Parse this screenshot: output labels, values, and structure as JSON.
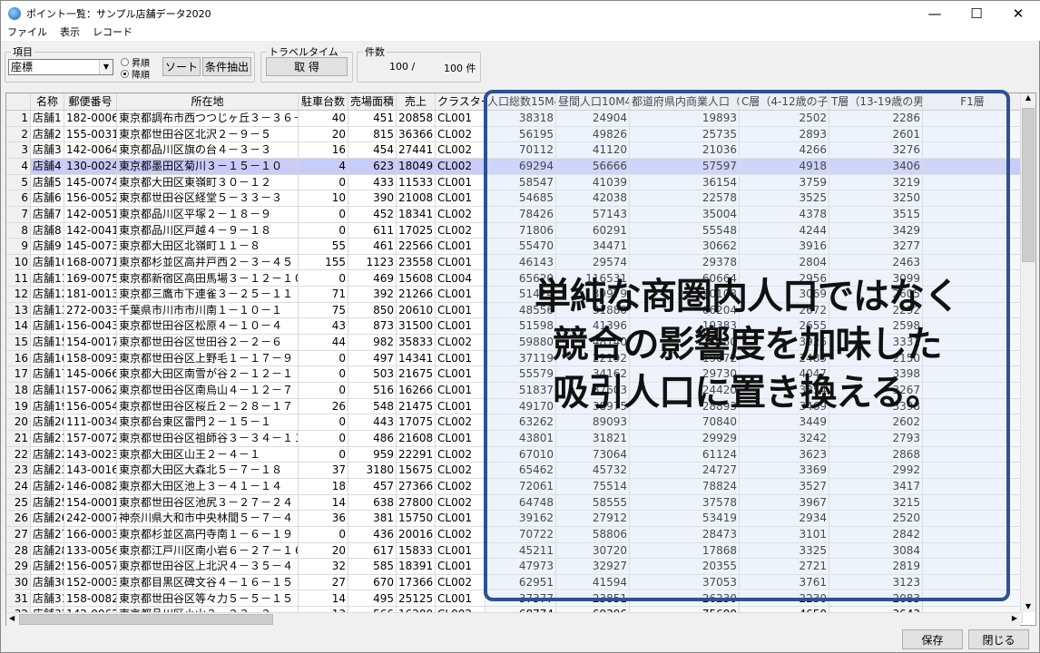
{
  "window": {
    "title": "ポイント一覧：サンプル店舗データ2020",
    "minimize": "—",
    "maximize": "☐",
    "close": "✕"
  },
  "menu": [
    "ファイル",
    "表示",
    "レコード"
  ],
  "toolbar": {
    "item_group": "項目",
    "item_value": "座標",
    "asc": "昇順",
    "desc": "降順",
    "sort_order": "desc",
    "sort_button": "ソート",
    "filter_button": "条件抽出",
    "travel_group": "トラベルタイム",
    "get_button": "取 得",
    "count_group": "件数",
    "count_shown": "100 /",
    "count_total": "100 件"
  },
  "columns": [
    "",
    "名称",
    "郵便番号",
    "所在地",
    "駐車台数",
    "売場面積",
    "売上",
    "クラスター",
    "人口総数15M4W",
    "昼間人口10M4W",
    "都道府県内商業人口（人）",
    "C層（4-12歳の子供）",
    "T層（13-19歳の男女",
    "F1層"
  ],
  "selected_row": 4,
  "rows": [
    [
      "1",
      "店舗1",
      "182-0006",
      "東京都調布市西つつじヶ丘３－３６－１",
      "40",
      "451",
      "20858",
      "CL001",
      "38318",
      "24904",
      "19893",
      "2502",
      "2286",
      ""
    ],
    [
      "2",
      "店舗2",
      "155-0031",
      "東京都世田谷区北沢２－９－５",
      "20",
      "815",
      "36366",
      "CL002",
      "56195",
      "49826",
      "25735",
      "2893",
      "2601",
      ""
    ],
    [
      "3",
      "店舗3",
      "142-0064",
      "東京都品川区旗の台４－３－３",
      "16",
      "454",
      "27441",
      "CL002",
      "70112",
      "41120",
      "21036",
      "4266",
      "3276",
      ""
    ],
    [
      "4",
      "店舗4",
      "130-0024",
      "東京都墨田区菊川３－１５－１０",
      "4",
      "623",
      "18049",
      "CL002",
      "69294",
      "56666",
      "57597",
      "4918",
      "3406",
      ""
    ],
    [
      "5",
      "店舗5",
      "145-0074",
      "東京都大田区東嶺町３０－１２",
      "0",
      "433",
      "11533",
      "CL001",
      "58547",
      "41039",
      "36154",
      "3759",
      "3219",
      ""
    ],
    [
      "6",
      "店舗6",
      "156-0052",
      "東京都世田谷区経堂５－３３－３",
      "10",
      "390",
      "21008",
      "CL001",
      "54685",
      "42038",
      "22578",
      "3525",
      "3250",
      ""
    ],
    [
      "7",
      "店舗7",
      "142-0051",
      "東京都品川区平塚２－１８－９",
      "0",
      "452",
      "18341",
      "CL002",
      "78426",
      "57143",
      "35004",
      "4378",
      "3515",
      ""
    ],
    [
      "8",
      "店舗8",
      "142-0041",
      "東京都品川区戸越４－９－１８",
      "0",
      "611",
      "17025",
      "CL002",
      "71806",
      "60291",
      "55548",
      "4244",
      "3429",
      ""
    ],
    [
      "9",
      "店舗9",
      "145-0073",
      "東京都大田区北嶺町１１－８",
      "55",
      "461",
      "22566",
      "CL001",
      "55470",
      "34471",
      "30662",
      "3916",
      "3277",
      ""
    ],
    [
      "10",
      "店舗10",
      "168-0071",
      "東京都杉並区高井戸西２－３－４５",
      "155",
      "1123",
      "23558",
      "CL001",
      "46143",
      "29574",
      "29378",
      "2804",
      "2463",
      ""
    ],
    [
      "11",
      "店舗11",
      "169-0075",
      "東京都新宿区高田馬場３－１２－１０",
      "0",
      "469",
      "15608",
      "CL004",
      "65620",
      "116531",
      "60664",
      "2956",
      "3099",
      ""
    ],
    [
      "12",
      "店舗12",
      "181-0013",
      "東京都三鷹市下連雀３－２５－１１",
      "71",
      "392",
      "21266",
      "CL001",
      "51424",
      "39979",
      "20108",
      "3069",
      "2605",
      ""
    ],
    [
      "13",
      "店舗13",
      "272-0033",
      "千葉県市川市市川南１－１０－１",
      "75",
      "850",
      "20610",
      "CL001",
      "48556",
      "31880",
      "66204",
      "2672",
      "2292",
      ""
    ],
    [
      "14",
      "店舗14",
      "156-0043",
      "東京都世田谷区松原４－１０－４",
      "43",
      "873",
      "31500",
      "CL001",
      "51598",
      "41396",
      "19383",
      "2655",
      "2598",
      ""
    ],
    [
      "15",
      "店舗15",
      "154-0017",
      "東京都世田谷区世田谷２－２－６",
      "44",
      "982",
      "35833",
      "CL002",
      "59880",
      "48140",
      "21550",
      "3926",
      "3331",
      ""
    ],
    [
      "16",
      "店舗16",
      "158-0093",
      "東京都世田谷区上野毛１－１７－９",
      "0",
      "497",
      "14341",
      "CL001",
      "37119",
      "22192",
      "19072",
      "2483",
      "2150",
      ""
    ],
    [
      "17",
      "店舗17",
      "145-0066",
      "東京都大田区南雪が谷２－１２－１",
      "0",
      "503",
      "21675",
      "CL001",
      "55579",
      "34162",
      "29730",
      "4047",
      "3398",
      ""
    ],
    [
      "18",
      "店舗18",
      "157-0062",
      "東京都世田谷区南烏山４－１２－７ ク",
      "0",
      "516",
      "16266",
      "CL001",
      "51837",
      "37603",
      "24420",
      "3854",
      "3267",
      ""
    ],
    [
      "19",
      "店舗19",
      "156-0054",
      "東京都世田谷区桜丘２－２８－１７",
      "26",
      "548",
      "21475",
      "CL001",
      "49170",
      "38975",
      "28893",
      "3469",
      "3398",
      ""
    ],
    [
      "20",
      "店舗20",
      "111-0034",
      "東京都台東区雷門２－１５－１",
      "0",
      "443",
      "17075",
      "CL002",
      "63262",
      "89093",
      "70840",
      "3449",
      "2602",
      ""
    ],
    [
      "21",
      "店舗21",
      "157-0072",
      "東京都世田谷区祖師谷３－３４－１１",
      "0",
      "486",
      "21608",
      "CL001",
      "43801",
      "31821",
      "29929",
      "3242",
      "2793",
      ""
    ],
    [
      "22",
      "店舗22",
      "143-0023",
      "東京都大田区山王２－４－１",
      "0",
      "959",
      "22291",
      "CL002",
      "67010",
      "73064",
      "61124",
      "3623",
      "2868",
      ""
    ],
    [
      "23",
      "店舗23",
      "143-0016",
      "東京都大田区大森北５－７－１８",
      "37",
      "3180",
      "15675",
      "CL002",
      "65462",
      "45732",
      "24727",
      "3369",
      "2992",
      ""
    ],
    [
      "24",
      "店舗24",
      "146-0082",
      "東京都大田区池上３－４１－１４",
      "18",
      "457",
      "27366",
      "CL002",
      "72061",
      "75514",
      "78824",
      "3527",
      "3417",
      ""
    ],
    [
      "25",
      "店舗25",
      "154-0001",
      "東京都世田谷区池尻３－２７－２４",
      "14",
      "638",
      "27800",
      "CL002",
      "64748",
      "58555",
      "37578",
      "3967",
      "3215",
      ""
    ],
    [
      "26",
      "店舗26",
      "242-0007",
      "神奈川県大和市中央林間５－７－４",
      "36",
      "381",
      "15750",
      "CL001",
      "39162",
      "27912",
      "53419",
      "2934",
      "2520",
      ""
    ],
    [
      "27",
      "店舗27",
      "166-0003",
      "東京都杉並区高円寺南１－６－１９",
      "0",
      "436",
      "20016",
      "CL002",
      "70722",
      "58806",
      "28473",
      "3101",
      "2842",
      ""
    ],
    [
      "28",
      "店舗28",
      "133-0056",
      "東京都江戸川区南小岩６－２７－１６",
      "20",
      "617",
      "15833",
      "CL001",
      "45211",
      "30720",
      "17868",
      "3325",
      "3084",
      ""
    ],
    [
      "29",
      "店舗29",
      "156-0057",
      "東京都世田谷区上北沢４－３５－４",
      "32",
      "585",
      "18391",
      "CL001",
      "47973",
      "32927",
      "20355",
      "2721",
      "2819",
      ""
    ],
    [
      "30",
      "店舗30",
      "152-0003",
      "東京都目黒区碑文谷４－１６－１５",
      "27",
      "670",
      "17366",
      "CL002",
      "62951",
      "41594",
      "37053",
      "3761",
      "3123",
      ""
    ],
    [
      "31",
      "店舗31",
      "158-0082",
      "東京都世田谷区等々力５－５－１５",
      "14",
      "495",
      "25125",
      "CL001",
      "37377",
      "23851",
      "26230",
      "2230",
      "2083",
      ""
    ],
    [
      "32",
      "店舗32",
      "142-0062",
      "東京都品川区小山３－２３－２",
      "13",
      "566",
      "16280",
      "CL002",
      "68774",
      "69396",
      "75690",
      "4650",
      "3643",
      ""
    ]
  ],
  "footer": {
    "save_button": "保存",
    "close_button": "閉じる"
  },
  "annotation": {
    "lines": [
      "単純な商圏内人口ではなく",
      "競合の影響度を加味した",
      "吸引人口に置き換える。"
    ],
    "border_color": "#2f5193"
  }
}
